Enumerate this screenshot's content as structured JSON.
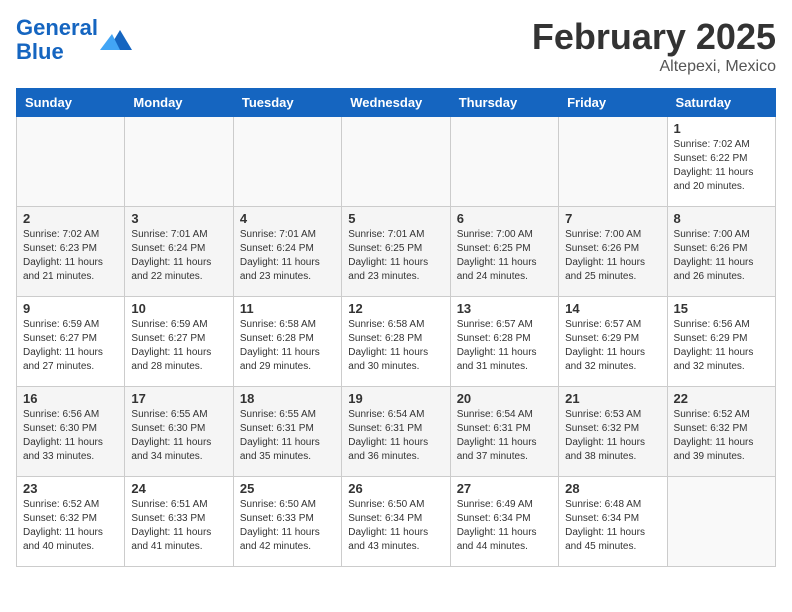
{
  "header": {
    "logo_line1": "General",
    "logo_line2": "Blue",
    "title": "February 2025",
    "subtitle": "Altepexi, Mexico"
  },
  "days_of_week": [
    "Sunday",
    "Monday",
    "Tuesday",
    "Wednesday",
    "Thursday",
    "Friday",
    "Saturday"
  ],
  "weeks": [
    [
      {
        "day": "",
        "info": ""
      },
      {
        "day": "",
        "info": ""
      },
      {
        "day": "",
        "info": ""
      },
      {
        "day": "",
        "info": ""
      },
      {
        "day": "",
        "info": ""
      },
      {
        "day": "",
        "info": ""
      },
      {
        "day": "1",
        "info": "Sunrise: 7:02 AM\nSunset: 6:22 PM\nDaylight: 11 hours and 20 minutes."
      }
    ],
    [
      {
        "day": "2",
        "info": "Sunrise: 7:02 AM\nSunset: 6:23 PM\nDaylight: 11 hours and 21 minutes."
      },
      {
        "day": "3",
        "info": "Sunrise: 7:01 AM\nSunset: 6:24 PM\nDaylight: 11 hours and 22 minutes."
      },
      {
        "day": "4",
        "info": "Sunrise: 7:01 AM\nSunset: 6:24 PM\nDaylight: 11 hours and 23 minutes."
      },
      {
        "day": "5",
        "info": "Sunrise: 7:01 AM\nSunset: 6:25 PM\nDaylight: 11 hours and 23 minutes."
      },
      {
        "day": "6",
        "info": "Sunrise: 7:00 AM\nSunset: 6:25 PM\nDaylight: 11 hours and 24 minutes."
      },
      {
        "day": "7",
        "info": "Sunrise: 7:00 AM\nSunset: 6:26 PM\nDaylight: 11 hours and 25 minutes."
      },
      {
        "day": "8",
        "info": "Sunrise: 7:00 AM\nSunset: 6:26 PM\nDaylight: 11 hours and 26 minutes."
      }
    ],
    [
      {
        "day": "9",
        "info": "Sunrise: 6:59 AM\nSunset: 6:27 PM\nDaylight: 11 hours and 27 minutes."
      },
      {
        "day": "10",
        "info": "Sunrise: 6:59 AM\nSunset: 6:27 PM\nDaylight: 11 hours and 28 minutes."
      },
      {
        "day": "11",
        "info": "Sunrise: 6:58 AM\nSunset: 6:28 PM\nDaylight: 11 hours and 29 minutes."
      },
      {
        "day": "12",
        "info": "Sunrise: 6:58 AM\nSunset: 6:28 PM\nDaylight: 11 hours and 30 minutes."
      },
      {
        "day": "13",
        "info": "Sunrise: 6:57 AM\nSunset: 6:28 PM\nDaylight: 11 hours and 31 minutes."
      },
      {
        "day": "14",
        "info": "Sunrise: 6:57 AM\nSunset: 6:29 PM\nDaylight: 11 hours and 32 minutes."
      },
      {
        "day": "15",
        "info": "Sunrise: 6:56 AM\nSunset: 6:29 PM\nDaylight: 11 hours and 32 minutes."
      }
    ],
    [
      {
        "day": "16",
        "info": "Sunrise: 6:56 AM\nSunset: 6:30 PM\nDaylight: 11 hours and 33 minutes."
      },
      {
        "day": "17",
        "info": "Sunrise: 6:55 AM\nSunset: 6:30 PM\nDaylight: 11 hours and 34 minutes."
      },
      {
        "day": "18",
        "info": "Sunrise: 6:55 AM\nSunset: 6:31 PM\nDaylight: 11 hours and 35 minutes."
      },
      {
        "day": "19",
        "info": "Sunrise: 6:54 AM\nSunset: 6:31 PM\nDaylight: 11 hours and 36 minutes."
      },
      {
        "day": "20",
        "info": "Sunrise: 6:54 AM\nSunset: 6:31 PM\nDaylight: 11 hours and 37 minutes."
      },
      {
        "day": "21",
        "info": "Sunrise: 6:53 AM\nSunset: 6:32 PM\nDaylight: 11 hours and 38 minutes."
      },
      {
        "day": "22",
        "info": "Sunrise: 6:52 AM\nSunset: 6:32 PM\nDaylight: 11 hours and 39 minutes."
      }
    ],
    [
      {
        "day": "23",
        "info": "Sunrise: 6:52 AM\nSunset: 6:32 PM\nDaylight: 11 hours and 40 minutes."
      },
      {
        "day": "24",
        "info": "Sunrise: 6:51 AM\nSunset: 6:33 PM\nDaylight: 11 hours and 41 minutes."
      },
      {
        "day": "25",
        "info": "Sunrise: 6:50 AM\nSunset: 6:33 PM\nDaylight: 11 hours and 42 minutes."
      },
      {
        "day": "26",
        "info": "Sunrise: 6:50 AM\nSunset: 6:34 PM\nDaylight: 11 hours and 43 minutes."
      },
      {
        "day": "27",
        "info": "Sunrise: 6:49 AM\nSunset: 6:34 PM\nDaylight: 11 hours and 44 minutes."
      },
      {
        "day": "28",
        "info": "Sunrise: 6:48 AM\nSunset: 6:34 PM\nDaylight: 11 hours and 45 minutes."
      },
      {
        "day": "",
        "info": ""
      }
    ]
  ]
}
